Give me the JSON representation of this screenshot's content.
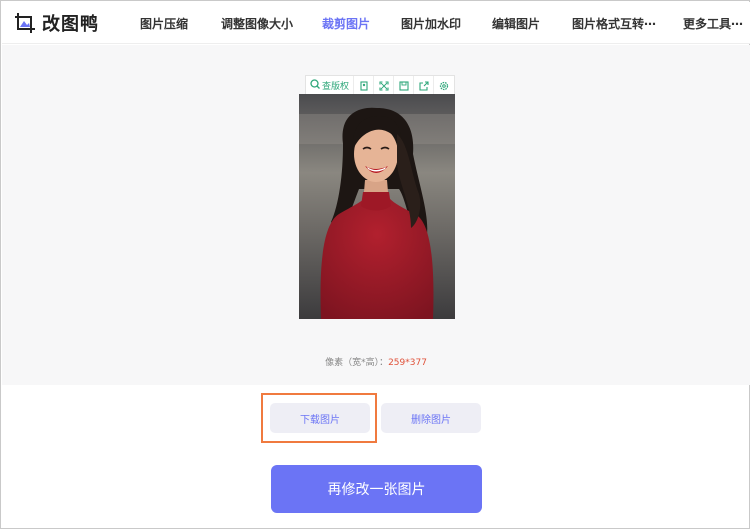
{
  "brand": {
    "logo_text": "改图鸭"
  },
  "nav": {
    "items": [
      {
        "label": "图片压缩"
      },
      {
        "label": "调整图像大小"
      },
      {
        "label": "裁剪图片",
        "active": true
      },
      {
        "label": "图片加水印"
      },
      {
        "label": "编辑图片"
      },
      {
        "label": "图片格式互转⋯"
      },
      {
        "label": "更多工具⋯"
      }
    ]
  },
  "toolbar": {
    "first_label": "查版权",
    "icons": [
      "copyright-search-icon",
      "portrait-icon",
      "fullscreen-icon",
      "save-icon",
      "share-icon",
      "settings-icon"
    ]
  },
  "image": {
    "alt_subject": "smiling woman in red sweater"
  },
  "pixel_info": {
    "label": "像素（宽*高）：",
    "value": "259*377"
  },
  "actions": {
    "download_label": "下载图片",
    "delete_label": "删除图片",
    "redo_label": "再修改一张图片"
  },
  "colors": {
    "accent": "#6b74f5",
    "highlight": "#f07a3f",
    "pixel_value": "#e0523a",
    "toolbar_green": "#2ea77a"
  }
}
